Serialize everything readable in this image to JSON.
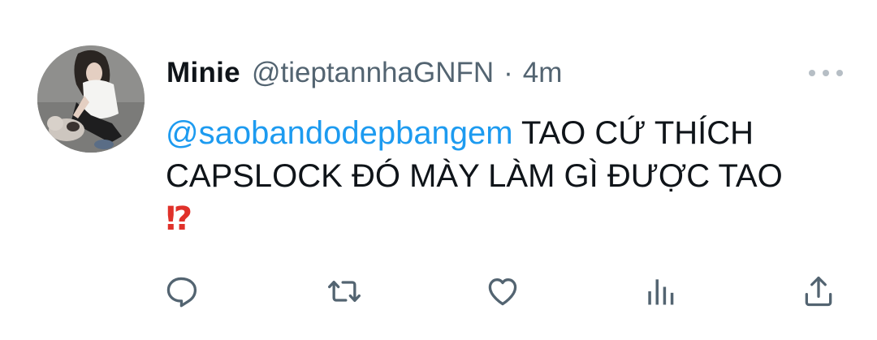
{
  "tweet": {
    "author_name": "Minie",
    "author_handle": "@tieptannhaGNFN",
    "separator": "·",
    "timestamp": "4m",
    "mention": "@saobandodepbangem",
    "text_line1": " TAO CỨ THÍCH",
    "text_line2": "CAPSLOCK ĐÓ MÀY LÀM GÌ ĐƯỢC TAO",
    "emoji": "⁉"
  },
  "actions": [
    {
      "name": "reply",
      "icon": "reply-icon"
    },
    {
      "name": "retweet",
      "icon": "retweet-icon"
    },
    {
      "name": "like",
      "icon": "heart-icon"
    },
    {
      "name": "analytics",
      "icon": "analytics-icon"
    },
    {
      "name": "share",
      "icon": "share-icon"
    }
  ],
  "colors": {
    "accent": "#1d9bf0",
    "secondary_text": "#536471",
    "primary_text": "#0f1419",
    "icon_gray": "#536471",
    "emoji_red": "#e0312a"
  }
}
